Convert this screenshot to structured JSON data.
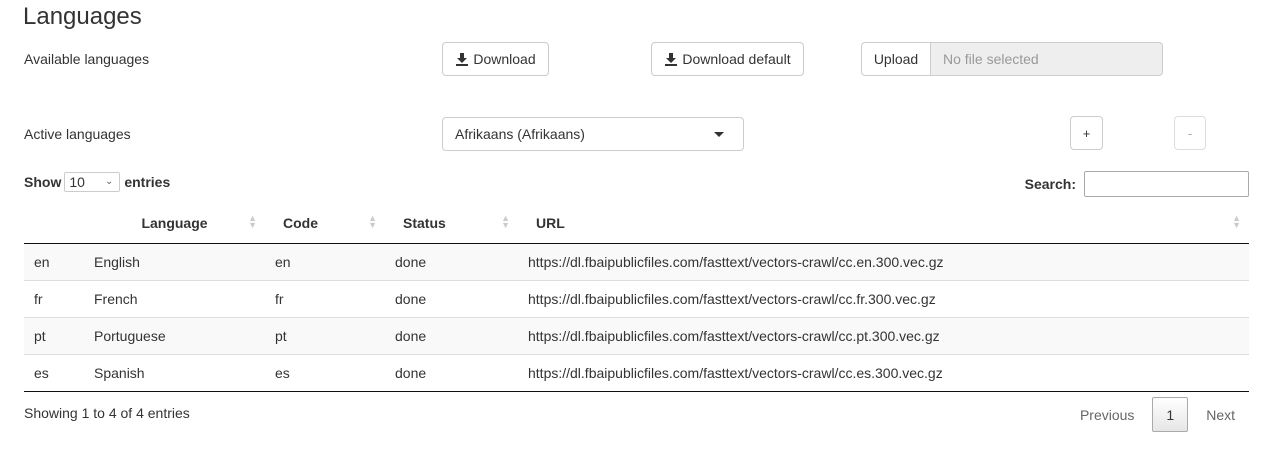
{
  "page": {
    "title": "Languages"
  },
  "available": {
    "label": "Available languages",
    "download_label": "Download",
    "download_default_label": "Download default",
    "upload_label": "Upload",
    "upload_placeholder": "No file selected"
  },
  "active": {
    "label": "Active languages",
    "selected": "Afrikaans (Afrikaans)",
    "add_label": "+",
    "remove_label": "-"
  },
  "table_controls": {
    "show_label": "Show",
    "page_length": "10",
    "entries_label": "entries",
    "search_label": "Search:"
  },
  "table": {
    "columns": [
      "",
      "Language",
      "Code",
      "Status",
      "URL"
    ],
    "rows": [
      [
        "en",
        "English",
        "en",
        "done",
        "https://dl.fbaipublicfiles.com/fasttext/vectors-crawl/cc.en.300.vec.gz"
      ],
      [
        "fr",
        "French",
        "fr",
        "done",
        "https://dl.fbaipublicfiles.com/fasttext/vectors-crawl/cc.fr.300.vec.gz"
      ],
      [
        "pt",
        "Portuguese",
        "pt",
        "done",
        "https://dl.fbaipublicfiles.com/fasttext/vectors-crawl/cc.pt.300.vec.gz"
      ],
      [
        "es",
        "Spanish",
        "es",
        "done",
        "https://dl.fbaipublicfiles.com/fasttext/vectors-crawl/cc.es.300.vec.gz"
      ]
    ]
  },
  "footer": {
    "info": "Showing 1 to 4 of 4 entries",
    "previous": "Previous",
    "current_page": "1",
    "next": "Next"
  }
}
